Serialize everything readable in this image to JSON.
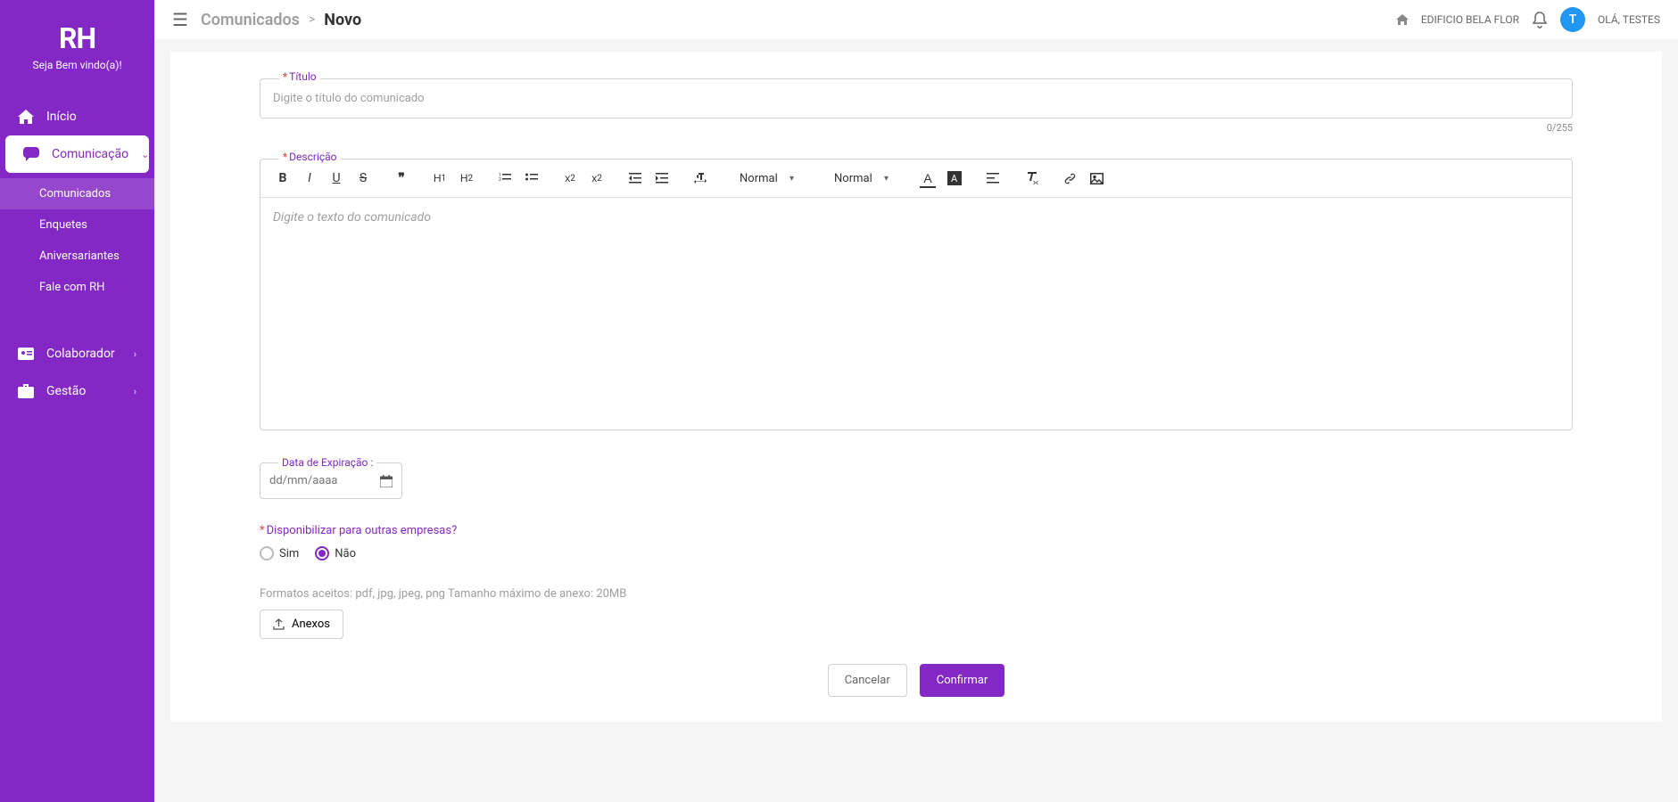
{
  "brand": {
    "logo": "RH",
    "welcome": "Seja Bem vindo(a)!"
  },
  "nav": {
    "inicio": "Início",
    "comunicacao": "Comunicação",
    "colaborador": "Colaborador",
    "gestao": "Gestão"
  },
  "subnav": {
    "comunicados": "Comunicados",
    "enquetes": "Enquetes",
    "aniversariantes": "Aniversariantes",
    "fale_com_rh": "Fale com RH"
  },
  "topbar": {
    "parent": "Comunicados",
    "sep": ">",
    "current": "Novo",
    "building": "EDIFICIO BELA FLOR",
    "avatar_letter": "T",
    "greeting": "OLÁ, TESTES"
  },
  "form": {
    "titulo_label": "Título",
    "titulo_placeholder": "Digite o título do comunicado",
    "titulo_counter": "0/255",
    "descricao_label": "Descrição",
    "descricao_placeholder": "Digite o texto do comunicado",
    "toolbar": {
      "select1": "Normal",
      "select2": "Normal"
    },
    "data_exp_label": "Data de Expiração :",
    "data_exp_placeholder": "dd/mm/aaaa",
    "question": "Disponibilizar para outras empresas?",
    "radio_sim": "Sim",
    "radio_nao": "Não",
    "hint": "Formatos aceitos: pdf, jpg, jpeg, png Tamanho máximo de anexo: 20MB",
    "anexos": "Anexos",
    "cancelar": "Cancelar",
    "confirmar": "Confirmar",
    "asterisk": "*"
  }
}
